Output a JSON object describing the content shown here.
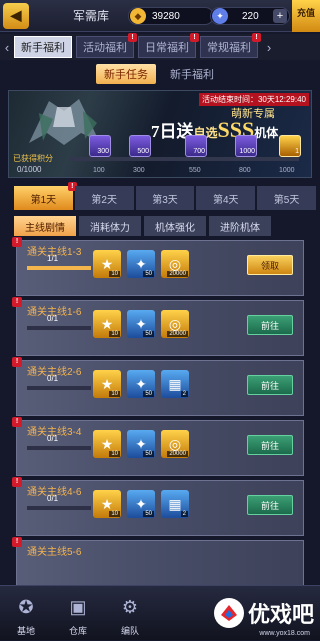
{
  "topbar": {
    "back_icon": "chevron-left-icon",
    "title": "军需库",
    "gold_value": "39280",
    "crystal_value": "220",
    "plus": "+",
    "recharge": "充值"
  },
  "tabs": [
    {
      "label": "新手福利",
      "active": true
    },
    {
      "label": "活动福利",
      "active": false
    },
    {
      "label": "日常福利",
      "active": false
    },
    {
      "label": "常规福利",
      "active": false
    }
  ],
  "subtabs": [
    {
      "label": "新手任务",
      "active": true
    },
    {
      "label": "新手福利",
      "active": false
    }
  ],
  "banner": {
    "timer": "活动结束时间：30天12:29:40",
    "subtitle": "萌新专属",
    "main_prefix": "7日送",
    "main_mid": "自选",
    "main_sss": "SSS",
    "main_suffix": "机体",
    "score_label": "已获得积分",
    "score_value": "0/1000",
    "milestones": [
      {
        "qty": "300",
        "threshold": "100"
      },
      {
        "qty": "500",
        "threshold": "300"
      },
      {
        "qty": "700",
        "threshold": "550"
      },
      {
        "qty": "1000",
        "threshold": "800"
      },
      {
        "qty": "1",
        "threshold": "1000"
      }
    ]
  },
  "days": [
    "第1天",
    "第2天",
    "第3天",
    "第4天",
    "第5天"
  ],
  "categories": [
    "主线剧情",
    "消耗体力",
    "机体强化",
    "进阶机体"
  ],
  "quests": [
    {
      "title": "通关主线1-3",
      "progress": "1/1",
      "progress_fraction": 1.0,
      "rewards": [
        {
          "q": "10"
        },
        {
          "q": "50"
        },
        {
          "q": "20000"
        }
      ],
      "button": "领取",
      "claim": true
    },
    {
      "title": "通关主线1-6",
      "progress": "0/1",
      "progress_fraction": 0.0,
      "rewards": [
        {
          "q": "10"
        },
        {
          "q": "50"
        },
        {
          "q": "20000"
        }
      ],
      "button": "前往",
      "claim": false
    },
    {
      "title": "通关主线2-6",
      "progress": "0/1",
      "progress_fraction": 0.0,
      "rewards": [
        {
          "q": "10"
        },
        {
          "q": "50"
        },
        {
          "q": "2"
        }
      ],
      "button": "前往",
      "claim": false
    },
    {
      "title": "通关主线3-4",
      "progress": "0/1",
      "progress_fraction": 0.0,
      "rewards": [
        {
          "q": "10"
        },
        {
          "q": "50"
        },
        {
          "q": "20000"
        }
      ],
      "button": "前往",
      "claim": false
    },
    {
      "title": "通关主线4-6",
      "progress": "0/1",
      "progress_fraction": 0.0,
      "rewards": [
        {
          "q": "10"
        },
        {
          "q": "50"
        },
        {
          "q": "2"
        }
      ],
      "button": "前往",
      "claim": false
    },
    {
      "title": "通关主线5-6",
      "progress": "",
      "progress_fraction": 0.0,
      "rewards": [],
      "button": "",
      "claim": false
    }
  ],
  "bottomnav": [
    {
      "label": "基地"
    },
    {
      "label": "仓库"
    },
    {
      "label": "编队"
    }
  ],
  "watermark": {
    "text": "优戏吧",
    "sub": "www.yox18.com"
  }
}
